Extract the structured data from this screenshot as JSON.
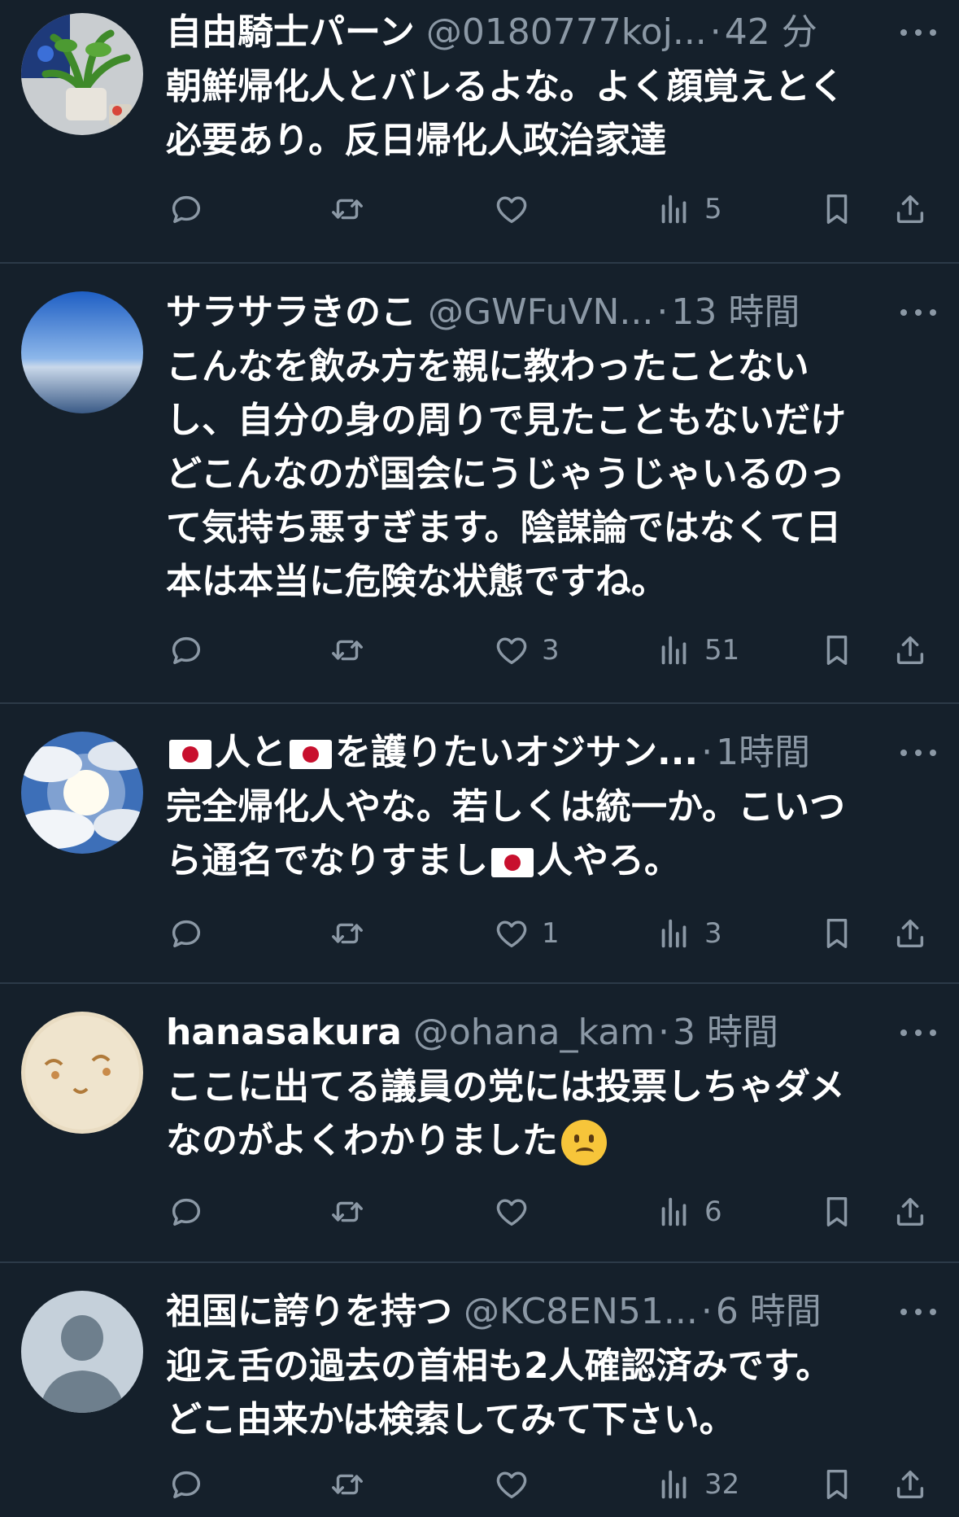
{
  "tweets": [
    {
      "name": "自由騎士パーン",
      "handle": "@0180777koj...",
      "time": "42 分",
      "body": "朝鮮帰化人とバレるよな。よく顔覚えとく\n必要あり。反日帰化人政治家達",
      "likes": "",
      "views": "5",
      "avatar": "plant-photo"
    },
    {
      "name": "サラサラきのこ",
      "handle": "@GWFuVN...",
      "time": "13 時間",
      "body": "こんなを飲み方を親に教わったことない\nし、自分の身の周りで見たこともないだけ\nどこんなのが国会にうじゃうじゃいるのっ\nて気持ち悪すぎます。陰謀論ではなくて日\n本は本当に危険な状態ですね。",
      "likes": "3",
      "views": "51",
      "avatar": "sky-photo"
    },
    {
      "name_part1": "人と",
      "name_part2": "を護りたいオジサン...",
      "time": "1時間",
      "body_part1": "完全帰化人やな。若しくは統一か。こいつ\nら通名でなりすまし",
      "body_part2": "人やろ。",
      "likes": "1",
      "views": "3",
      "avatar": "clouds-sun-photo"
    },
    {
      "name": "hanasakura",
      "handle": "@ohana_kam",
      "time": "3 時間",
      "body": "ここに出てる議員の党には投票しちゃダメ\nなのがよくわかりました",
      "likes": "",
      "views": "6",
      "avatar": "face-drawing"
    },
    {
      "name": "祖国に誇りを持つ",
      "handle": "@KC8EN51...",
      "time": "6 時間",
      "body": "迎え舌の過去の首相も2人確認済みです。\nどこ由来かは検索してみて下さい。",
      "likes": "",
      "views": "32",
      "avatar": "default-profile"
    }
  ],
  "separator": "·",
  "colors": {
    "background": "#15202b",
    "text": "#ffffff",
    "muted": "#8b98a5",
    "divider": "#2c3a48"
  },
  "icons": [
    "reply-icon",
    "retweet-icon",
    "like-icon",
    "views-icon",
    "bookmark-icon",
    "share-icon",
    "more-icon"
  ]
}
